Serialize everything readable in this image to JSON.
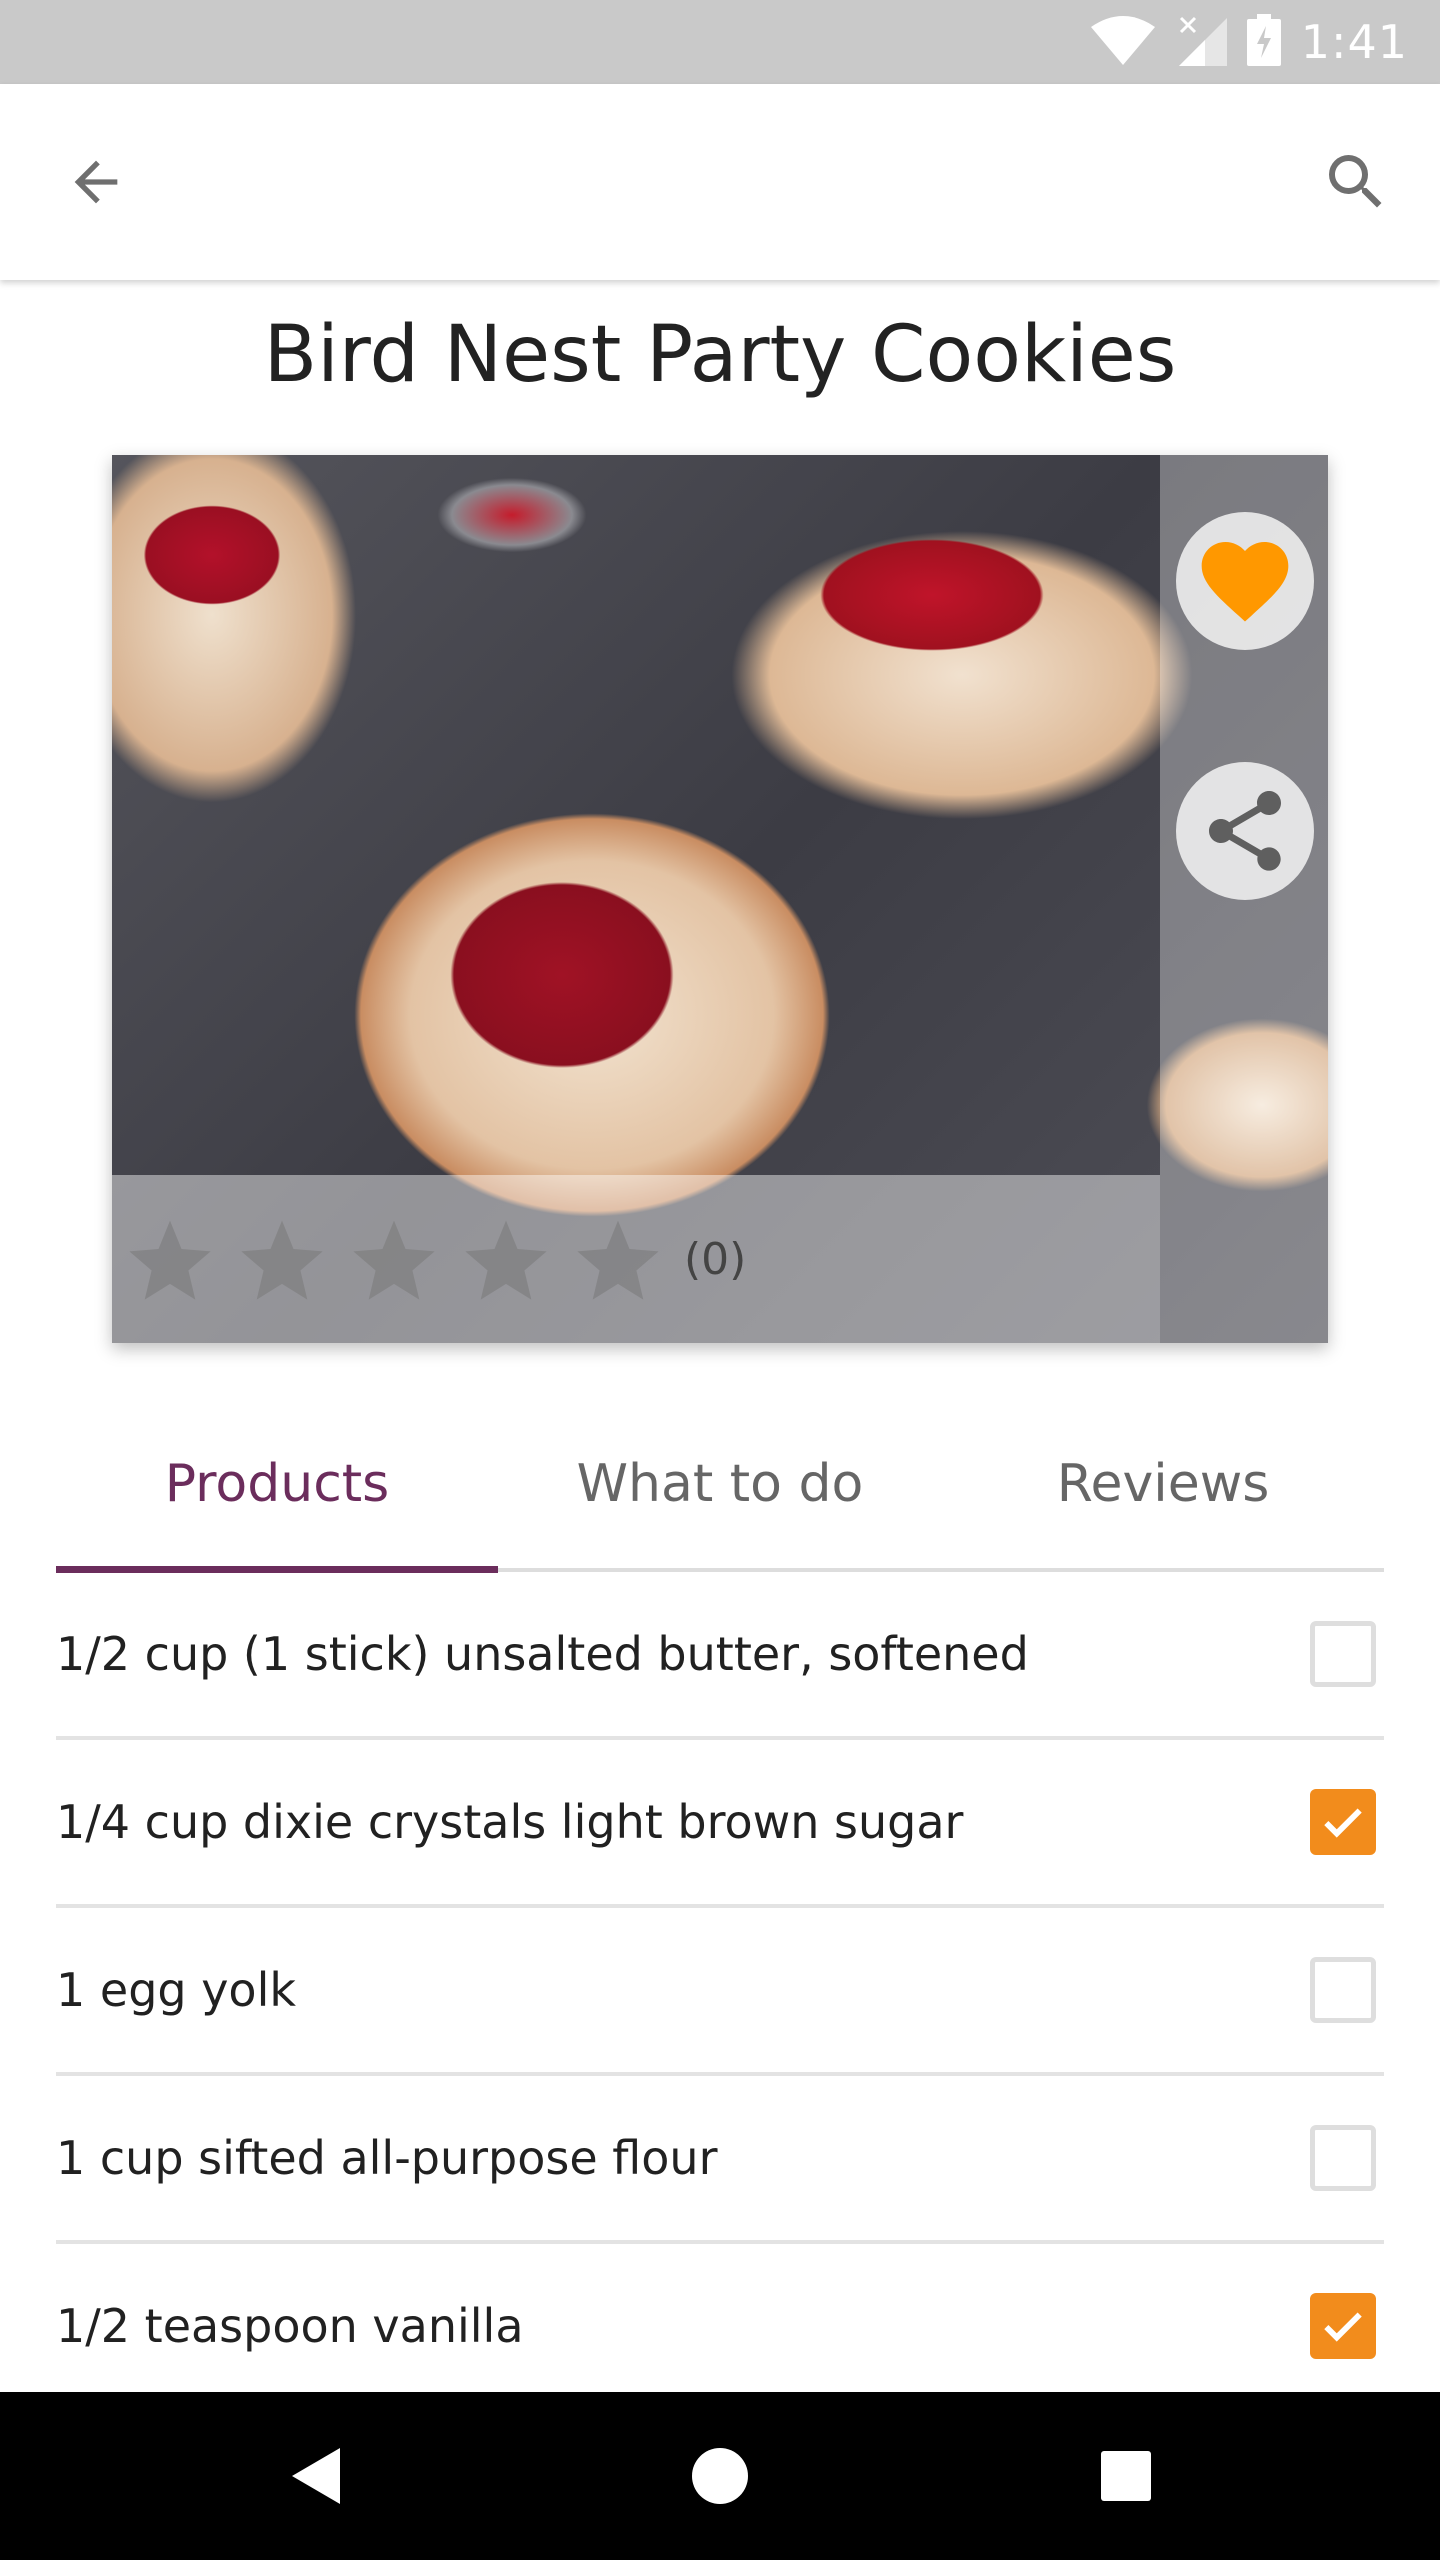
{
  "status_bar": {
    "time": "1:41",
    "icons": [
      "wifi-icon",
      "signal-off-icon",
      "battery-charging-icon"
    ]
  },
  "app_bar": {
    "back_icon": "arrow-left-icon",
    "search_icon": "search-icon"
  },
  "recipe": {
    "title": "Bird Nest Party Cookies",
    "favorite": true,
    "rating": {
      "stars": 0,
      "max_stars": 5,
      "count_label": "(0)"
    }
  },
  "colors": {
    "accent": "#6b2d5c",
    "favorite": "#ff9800",
    "checkbox_checked": "#f28c1c"
  },
  "tabs": [
    {
      "label": "Products",
      "active": true
    },
    {
      "label": "What to do",
      "active": false
    },
    {
      "label": "Reviews",
      "active": false
    }
  ],
  "ingredients": [
    {
      "label": "1/2 cup (1 stick) unsalted butter, softened",
      "checked": false
    },
    {
      "label": "1/4 cup dixie crystals light brown sugar",
      "checked": true
    },
    {
      "label": "1 egg yolk",
      "checked": false
    },
    {
      "label": "1 cup sifted all-purpose flour",
      "checked": false
    },
    {
      "label": "1/2 teaspoon vanilla",
      "checked": true
    }
  ],
  "nav_bar": {
    "icons": [
      "nav-back-icon",
      "nav-home-icon",
      "nav-recents-icon"
    ]
  }
}
